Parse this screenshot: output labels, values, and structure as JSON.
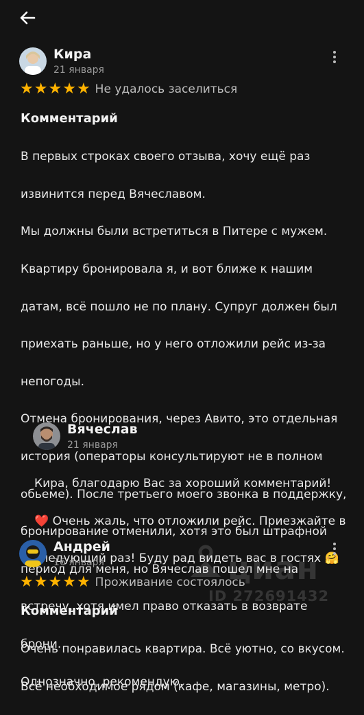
{
  "header": {
    "back_icon": "arrow-left-icon"
  },
  "reviews": [
    {
      "author": "Кира",
      "date": "21 января",
      "rating": 5,
      "rating_text": "Не удалось заселиться",
      "comment_heading": "Комментарий",
      "comment_lines": [
        "В первых строках своего отзыва, хочу ещё раз",
        "извинится перед Вячеславом.",
        "Мы должны были встретиться в Питере с мужем.",
        "Квартиру бронировала я, и вот ближе к нашим",
        "датам, всё пошло не по плану. Супруг должен был",
        "приехать раньше, но у него отложили рейс из-за",
        "непогоды.",
        "Отмена бронирования, через Авито, это отдельная",
        "история (операторы консультируют не в полном",
        "обьеме). После третьего моего звонка в поддержку,",
        "бронирование отменили, хотя это был штрафной",
        "период для меня, но Вячеслав пошел мне на",
        "встречу, хотя имел право отказать в возврате",
        "брони.",
        "Однозначно, рекомендую."
      ],
      "reply": {
        "author": "Вячеслав",
        "date": "21 января",
        "lines": [
          "Кира, благодарю Вас за хороший комментарий!",
          "Очень жаль, что отложили рейс. Приезжайте в",
          "следующий раз! Буду рад видеть вас в гостях"
        ],
        "emoji_heart": "❤️",
        "emoji_hug": "🤗"
      }
    },
    {
      "author": "Андрей",
      "date": "16 января",
      "rating": 5,
      "rating_text": "Проживание состоялось",
      "comment_heading": "Комментарий",
      "comment_lines": [
        "Очень понравилась квартира. Всё уютно, со вкусом.",
        "Всё необходимое рядом (кафе, магазины, метро)."
      ]
    }
  ],
  "watermark": {
    "brand": "циан",
    "id": "ID 272691432"
  },
  "colors": {
    "background": "#141414",
    "star": "#ffb300",
    "muted": "#9a9a9a"
  }
}
